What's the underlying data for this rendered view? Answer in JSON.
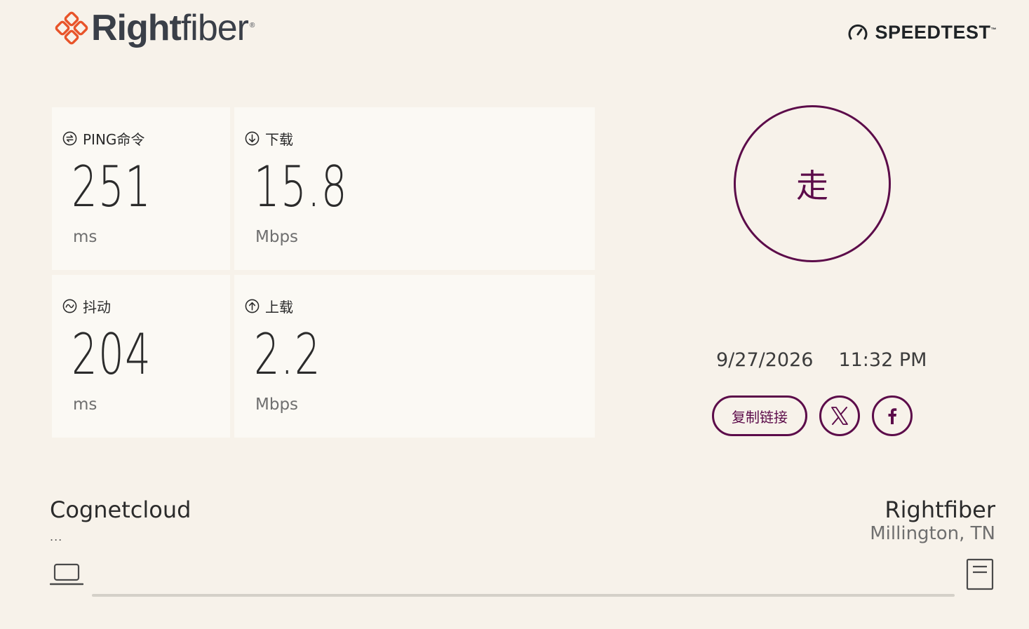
{
  "header": {
    "brand_bold": "Right",
    "brand_light": "fiber",
    "brand_mark": "®",
    "speedtest_label": "SPEEDTEST",
    "speedtest_mark": "™",
    "icons": {
      "brand": "rightfiber-logo-icon",
      "speedtest": "speedometer-icon"
    },
    "colors": {
      "brand_orange": "#e8542a",
      "brand_text": "#3a3f48"
    }
  },
  "metrics": {
    "ping": {
      "label": "PING命令",
      "value": "251",
      "unit": "ms",
      "icon": "ping-icon"
    },
    "download": {
      "label": "下载",
      "value": "15.8",
      "unit": "Mbps",
      "icon": "download-arrow-icon"
    },
    "jitter": {
      "label": "抖动",
      "value": "204",
      "unit": "ms",
      "icon": "jitter-wave-icon"
    },
    "upload": {
      "label": "上载",
      "value": "2.2",
      "unit": "Mbps",
      "icon": "upload-arrow-icon"
    }
  },
  "go_button": {
    "label": "走",
    "color": "#5c0c4a"
  },
  "result": {
    "date": "9/27/2026",
    "time": "11:32 PM"
  },
  "share": {
    "copy_link_label": "复制链接",
    "x_icon": "x-logo-icon",
    "facebook_icon": "facebook-icon"
  },
  "connection": {
    "isp_name": "Cognetcloud",
    "isp_ip": "...",
    "server_name": "Rightfiber",
    "server_location": "Millington, TN",
    "client_icon": "laptop-icon",
    "server_icon": "server-icon"
  }
}
